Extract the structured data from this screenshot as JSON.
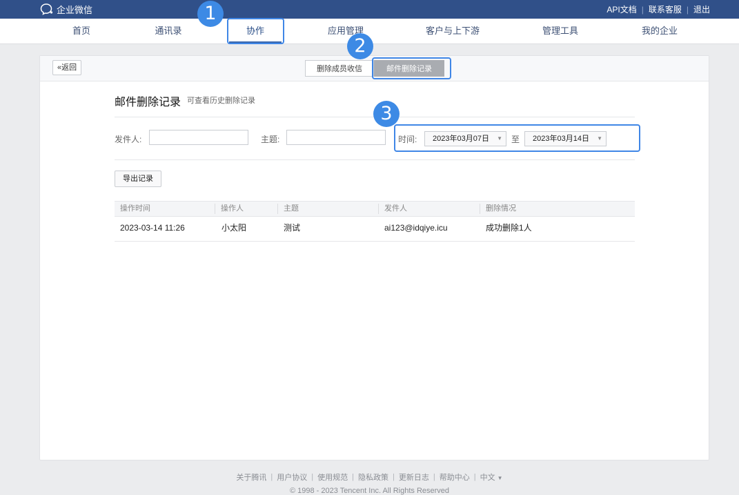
{
  "brand": {
    "name": "企业微信",
    "logo_icon": "chat-bubble-icon"
  },
  "top_links": [
    "API文档",
    "联系客服",
    "退出"
  ],
  "nav": {
    "items": [
      "首页",
      "通讯录",
      "协作",
      "应用管理",
      "客户与上下游",
      "管理工具",
      "我的企业"
    ],
    "active": "协作"
  },
  "badges": [
    "1",
    "2",
    "3"
  ],
  "toolbar": {
    "back_label": "返回",
    "tabs": [
      "删除成员收信",
      "邮件删除记录"
    ],
    "active_tab": "邮件删除记录"
  },
  "page": {
    "title": "邮件删除记录",
    "subtitle": "可查看历史删除记录"
  },
  "filters": {
    "sender_label": "发件人:",
    "sender_value": "",
    "subject_label": "主题:",
    "subject_value": "",
    "time_label": "时间:",
    "date_from": "2023年03月07日",
    "range_sep": "至",
    "date_to": "2023年03月14日"
  },
  "export_label": "导出记录",
  "table": {
    "columns": [
      "操作时间",
      "操作人",
      "主题",
      "发件人",
      "删除情况"
    ],
    "rows": [
      [
        "2023-03-14 11:26",
        "小太阳",
        "测试",
        "ai123@idqiye.icu",
        "成功删除1人"
      ]
    ]
  },
  "footer": {
    "links": [
      "关于腾讯",
      "用户协议",
      "使用规范",
      "隐私政策",
      "更新日志",
      "帮助中心",
      "中文"
    ],
    "copyright": "© 1998 - 2023 Tencent Inc. All Rights Reserved"
  }
}
